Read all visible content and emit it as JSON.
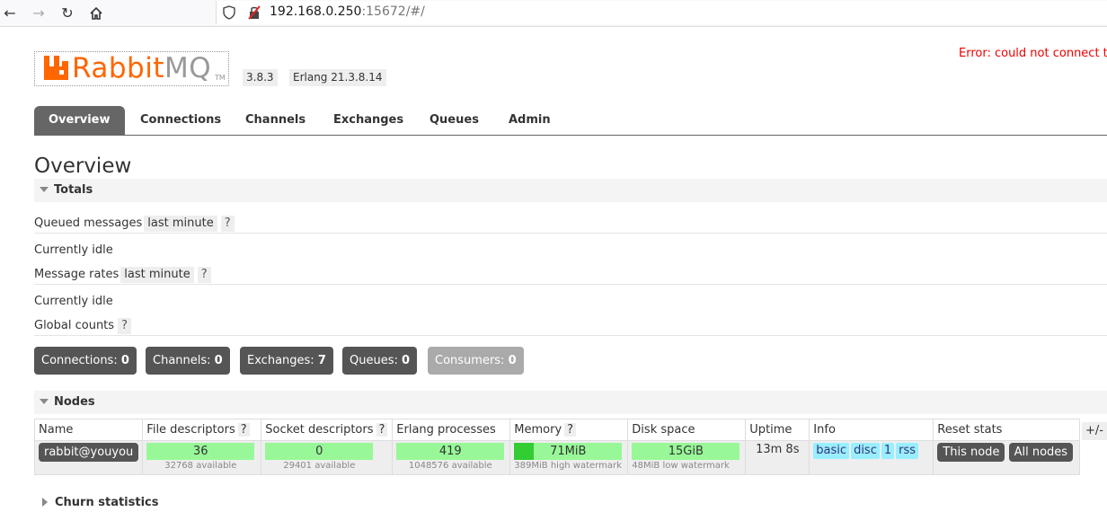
{
  "browser": {
    "url_host": "192.168.0.250",
    "url_rest": ":15672/#/"
  },
  "header": {
    "logo_rabbit": "Rabbit",
    "logo_mq": "MQ",
    "logo_tm": "TM",
    "version": "3.8.3",
    "erlang": "Erlang 21.3.8.14",
    "error": "Error: could not connect to"
  },
  "tabs": [
    "Overview",
    "Connections",
    "Channels",
    "Exchanges",
    "Queues",
    "Admin"
  ],
  "page_title": "Overview",
  "totals": {
    "heading": "Totals",
    "queued_label": "Queued messages",
    "queued_range": "last minute",
    "queued_state": "Currently idle",
    "rates_label": "Message rates",
    "rates_range": "last minute",
    "rates_state": "Currently idle",
    "global_label": "Global counts",
    "help": "?"
  },
  "counts": [
    {
      "label": "Connections:",
      "value": "0"
    },
    {
      "label": "Channels:",
      "value": "0"
    },
    {
      "label": "Exchanges:",
      "value": "7"
    },
    {
      "label": "Queues:",
      "value": "0"
    },
    {
      "label": "Consumers:",
      "value": "0"
    }
  ],
  "nodes": {
    "heading": "Nodes",
    "plus_minus": "+/-",
    "columns": [
      "Name",
      "File descriptors",
      "Socket descriptors",
      "Erlang processes",
      "Memory",
      "Disk space",
      "Uptime",
      "Info",
      "Reset stats"
    ],
    "row": {
      "name": "rabbit@youyou",
      "file_desc": "36",
      "file_desc_avail": "32768 available",
      "socket_desc": "0",
      "socket_desc_avail": "29401 available",
      "erlang_proc": "419",
      "erlang_proc_avail": "1048576 available",
      "memory": "71MiB",
      "memory_sub": "389MiB high watermark",
      "memory_fraction": 0.18,
      "disk": "15GiB",
      "disk_sub": "48MiB low watermark",
      "uptime": "13m 8s",
      "info": [
        "basic",
        "disc",
        "1",
        "rss"
      ],
      "reset_this": "This node",
      "reset_all": "All nodes"
    }
  },
  "churn": {
    "heading": "Churn statistics"
  }
}
